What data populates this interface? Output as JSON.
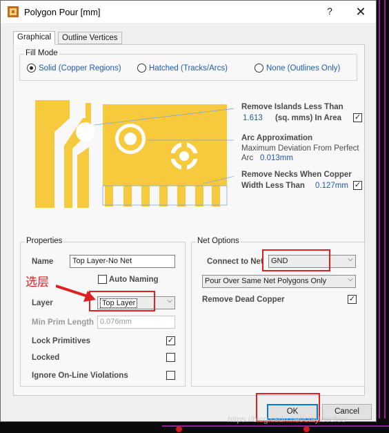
{
  "title": "Polygon Pour [mm]",
  "help_glyph": "?",
  "close_glyph": "✕",
  "tabs": [
    {
      "label": "Graphical",
      "active": true
    },
    {
      "label": "Outline Vertices",
      "active": false
    }
  ],
  "fill_mode": {
    "label": "Fill Mode",
    "options": [
      {
        "label": "Solid (Copper Regions)",
        "selected": true
      },
      {
        "label": "Hatched (Tracks/Arcs)",
        "selected": false
      },
      {
        "label": "None (Outlines Only)",
        "selected": false
      }
    ]
  },
  "islands": {
    "title": "Remove Islands Less Than",
    "value": "1.613",
    "unit": "(sq. mms) In Area",
    "checked": true
  },
  "arc": {
    "title": "Arc Approximation",
    "desc": "Maximum Deviation From Perfect",
    "arc_label": "Arc",
    "value": "0.013mm"
  },
  "necks": {
    "title": "Remove Necks When Copper",
    "width_label": "Width Less Than",
    "value": "0.127mm",
    "checked": true
  },
  "properties": {
    "label": "Properties",
    "name_label": "Name",
    "name_value": "Top Layer-No Net",
    "auto_naming_label": "Auto Naming",
    "auto_naming_checked": false,
    "layer_label": "Layer",
    "layer_value": "Top Layer",
    "min_prim_label": "Min Prim Length",
    "min_prim_value": "0.076mm",
    "lock_primitives_label": "Lock Primitives",
    "lock_primitives_checked": true,
    "locked_label": "Locked",
    "locked_checked": false,
    "ignore_label": "Ignore On-Line Violations",
    "ignore_checked": false
  },
  "net_options": {
    "label": "Net Options",
    "connect_label": "Connect to Net",
    "net_value": "GND",
    "pour_value": "Pour Over Same Net Polygons Only",
    "remove_dead_label": "Remove Dead Copper",
    "remove_dead_checked": true
  },
  "annotation": "选层",
  "buttons": {
    "ok": "OK",
    "cancel": "Cancel"
  },
  "watermark": "https://blog.csdn.net/ctaylovefoo",
  "colors": {
    "copper": "#f7c93d",
    "accent": "#1f5ab1",
    "highlight": "#e02020"
  }
}
